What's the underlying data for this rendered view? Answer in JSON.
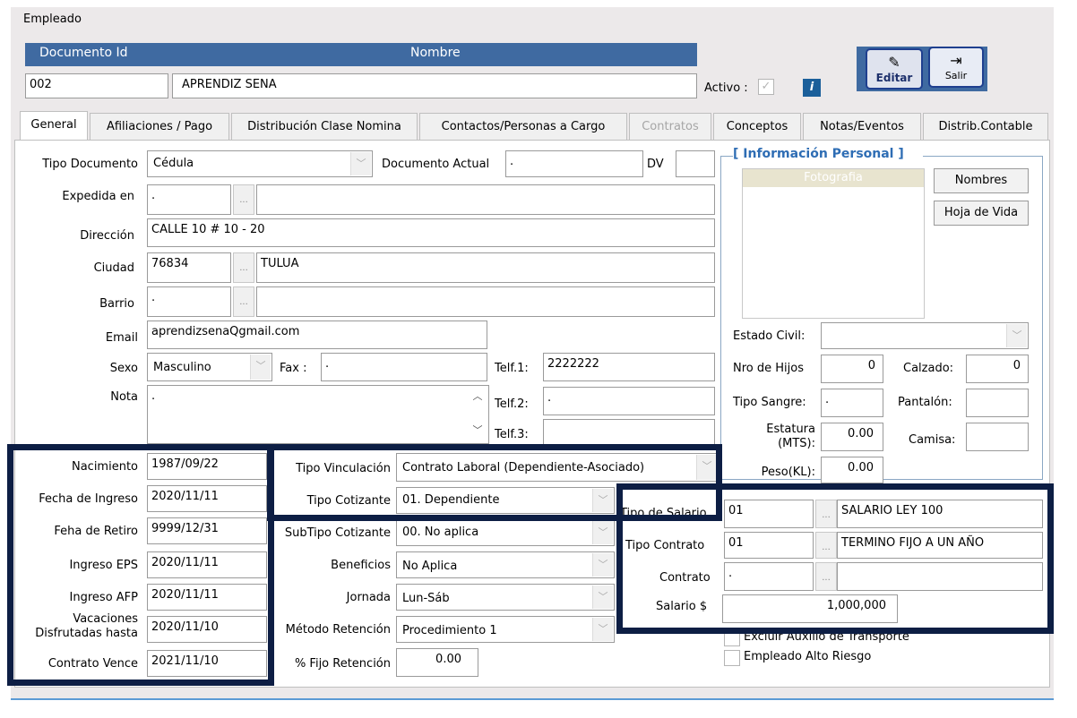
{
  "window": {
    "title": "Empleado"
  },
  "header": {
    "doc_id_label": "Documento Id",
    "nombre_label": "Nombre",
    "doc_id_value": "002",
    "nombre_value": "APRENDIZ SENA",
    "activo_label": "Activo :",
    "info_icon": "i"
  },
  "toolbar": {
    "editar_label": "Editar",
    "salir_label": "Salir"
  },
  "tabs": [
    {
      "label": "General"
    },
    {
      "label": "Afiliaciones / Pago"
    },
    {
      "label": "Distribución Clase Nomina"
    },
    {
      "label": "Contactos/Personas a Cargo"
    },
    {
      "label": "Contratos"
    },
    {
      "label": "Conceptos"
    },
    {
      "label": "Notas/Eventos"
    },
    {
      "label": "Distrib.Contable"
    }
  ],
  "general": {
    "tipo_documento_label": "Tipo Documento",
    "tipo_documento_value": "Cédula",
    "documento_actual_label": "Documento Actual",
    "documento_actual_value": ".",
    "dv_label": "DV",
    "dv_value": "",
    "expedida_label": "Expedida en",
    "expedida_code": ".",
    "expedida_name": "",
    "direccion_label": "Dirección",
    "direccion_value": "CALLE 10 # 10 - 20",
    "ciudad_label": "Ciudad",
    "ciudad_code": "76834",
    "ciudad_name": "TULUA",
    "barrio_label": "Barrio",
    "barrio_code": ".",
    "barrio_name": "",
    "email_label": "Email",
    "email_value": "aprendizsenaQgmail.com",
    "sexo_label": "Sexo",
    "sexo_value": "Masculino",
    "fax_label": "Fax :",
    "fax_value": ".",
    "telf1_label": "Telf.1:",
    "telf1_value": "2222222",
    "telf2_label": "Telf.2:",
    "telf2_value": ".",
    "telf3_label": "Telf.3:",
    "telf3_value": "",
    "nota_label": "Nota",
    "nota_value": ".",
    "dots": "..."
  },
  "fechas": {
    "nacimiento_label": "Nacimiento",
    "nacimiento_value": "1987/09/22",
    "ingreso_label": "Fecha de Ingreso",
    "ingreso_value": "2020/11/11",
    "retiro_label": "Feha de Retiro",
    "retiro_value": "9999/12/31",
    "eps_label": "Ingreso EPS",
    "eps_value": "2020/11/11",
    "afp_label": "Ingreso AFP",
    "afp_value": "2020/11/11",
    "vacaciones_label_1": "Vacaciones",
    "vacaciones_label_2": "Disfrutadas hasta",
    "vacaciones_value": "2020/11/10",
    "contrato_vence_label": "Contrato Vence",
    "contrato_vence_value": "2021/11/10"
  },
  "vinculacion": {
    "tipo_vinculacion_label": "Tipo Vinculación",
    "tipo_vinculacion_value": "Contrato Laboral (Dependiente-Asociado)",
    "tipo_cotizante_label": "Tipo Cotizante",
    "tipo_cotizante_value": "01. Dependiente",
    "subtipo_label": "SubTipo Cotizante",
    "subtipo_value": "00. No aplica",
    "beneficios_label": "Beneficios",
    "beneficios_value": "No Aplica",
    "jornada_label": "Jornada",
    "jornada_value": "Lun-Sáb",
    "metodo_label": "Método Retención",
    "metodo_value": "Procedimiento 1",
    "fijo_label": "% Fijo Retención",
    "fijo_value": "0.00"
  },
  "personal": {
    "section_title": "[ Información Personal ]",
    "foto_label": "Fotografia",
    "nombres_btn": "Nombres",
    "hoja_btn": "Hoja de Vida",
    "estado_civil_label": "Estado Civil:",
    "estado_civil_value": "",
    "hijos_label": "Nro de Hijos",
    "hijos_value": "0",
    "calzado_label": "Calzado:",
    "calzado_value": "0",
    "sangre_label": "Tipo Sangre:",
    "sangre_value": ".",
    "pantalon_label": "Pantalón:",
    "pantalon_value": "",
    "estatura_label_1": "Estatura",
    "estatura_label_2": "(MTS):",
    "estatura_value": "0.00",
    "camisa_label": "Camisa:",
    "camisa_value": "",
    "peso_label": "Peso(KL):",
    "peso_value": "0.00"
  },
  "salario": {
    "tipo_salario_label": "Tipo de Salario",
    "tipo_salario_code": "01",
    "tipo_salario_name": "SALARIO LEY 100",
    "tipo_contrato_label": "Tipo Contrato",
    "tipo_contrato_code": "01",
    "tipo_contrato_name": "TERMINO FIJO A UN AÑO",
    "contrato_label": "Contrato",
    "contrato_code": ".",
    "contrato_name": "",
    "salario_label": "Salario $",
    "salario_value": "1,000,000",
    "excluir_label": "Excluir Auxilio de Transporte",
    "alto_riesgo_label": "Empleado Alto Riesgo"
  }
}
